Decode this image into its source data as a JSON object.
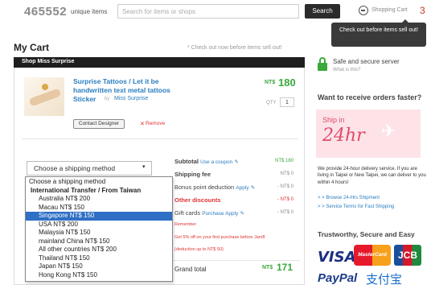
{
  "header": {
    "count": "465552",
    "count_label": "unique items",
    "search_placeholder": "Search for items or shops",
    "search_button": "Search",
    "cart_link": "Shopping Cart",
    "cart_count": "3",
    "tooltip": "Check out before items sell out!"
  },
  "page": {
    "title": "My Cart",
    "checkout_note": "* Check out now before items sell out!"
  },
  "shop": {
    "bar_label": "Shop Miss Surprise",
    "product_title": "Surprise Tattoos / Let it be handwritten text metal tattoos Sticker",
    "by": "by",
    "shop_name": "Miss Surprise",
    "price_currency": "NT$",
    "price": "180",
    "qty_label": "QTY",
    "qty": "1",
    "contact_button": "Contact Designer",
    "remove_icon": "✕",
    "remove_label": "Remove"
  },
  "shipping": {
    "select_label": "Choose a shipping method",
    "chevron": "▾",
    "options": [
      {
        "label": "Choose a shipping method",
        "kind": "plain"
      },
      {
        "label": "International Transfer / From Taiwan",
        "kind": "group"
      },
      {
        "label": "Australia NT$ 200",
        "kind": "indent"
      },
      {
        "label": "Macau NT$ 150",
        "kind": "indent"
      },
      {
        "label": "Singapore NT$ 150",
        "kind": "selected"
      },
      {
        "label": "USA NT$ 200",
        "kind": "indent"
      },
      {
        "label": "Malaysia NT$ 150",
        "kind": "indent"
      },
      {
        "label": "mainland China NT$ 150",
        "kind": "indent"
      },
      {
        "label": "All other countries NT$ 200",
        "kind": "indent"
      },
      {
        "label": "Thailand NT$ 150",
        "kind": "indent"
      },
      {
        "label": "Japan NT$ 150",
        "kind": "indent"
      },
      {
        "label": "Hong Kong NT$ 150",
        "kind": "indent"
      }
    ]
  },
  "totals": {
    "subtotal_label": "Subtotal",
    "use_coupon": "Use a coupon",
    "subtotal_value": "NT$ 180",
    "shipping_fee_label": "Shipping fee",
    "shipping_fee_value": "NT$ 0",
    "bonus_label": "Bonus point deduction",
    "bonus_apply": "Apply",
    "bonus_value": "- NT$ 0",
    "other_label": "Other discounts",
    "other_value": "- NT$ 0",
    "gift_label": "Gift cards",
    "gift_link": "Purchase Apply",
    "gift_value": "- NT$ 0",
    "promo_1": "Remember",
    "promo_2": "Get 5% off on your first purchase before Jan/8",
    "promo_3": "(deduction up to NT$ 50)",
    "grand_label": "Grand total",
    "grand_currency": "NT$",
    "grand_value": "171"
  },
  "sidebar": {
    "secure_title": "Safe and secure server",
    "what_is_this": "What is this?",
    "receive_heading": "Want to receive orders faster?",
    "banner_ship_in": "Ship in",
    "banner_24hr": "24hr",
    "banner_plane": "✈",
    "provide_text": "We provide 24-hour delivery service. If you are living in Taipei or New Taipei, we can deliver to you within 4 hours!",
    "link_1": "> > Browse 24-Hrs Shipment",
    "link_2": "> > Service Terms for Fast Shipping",
    "trust_heading": "Trustworthy, Secure and Easy",
    "visa": "VISA",
    "mastercard": "MasterCard",
    "jcb": "JCB",
    "paypal": "PayPal",
    "alipay": "支付宝"
  }
}
